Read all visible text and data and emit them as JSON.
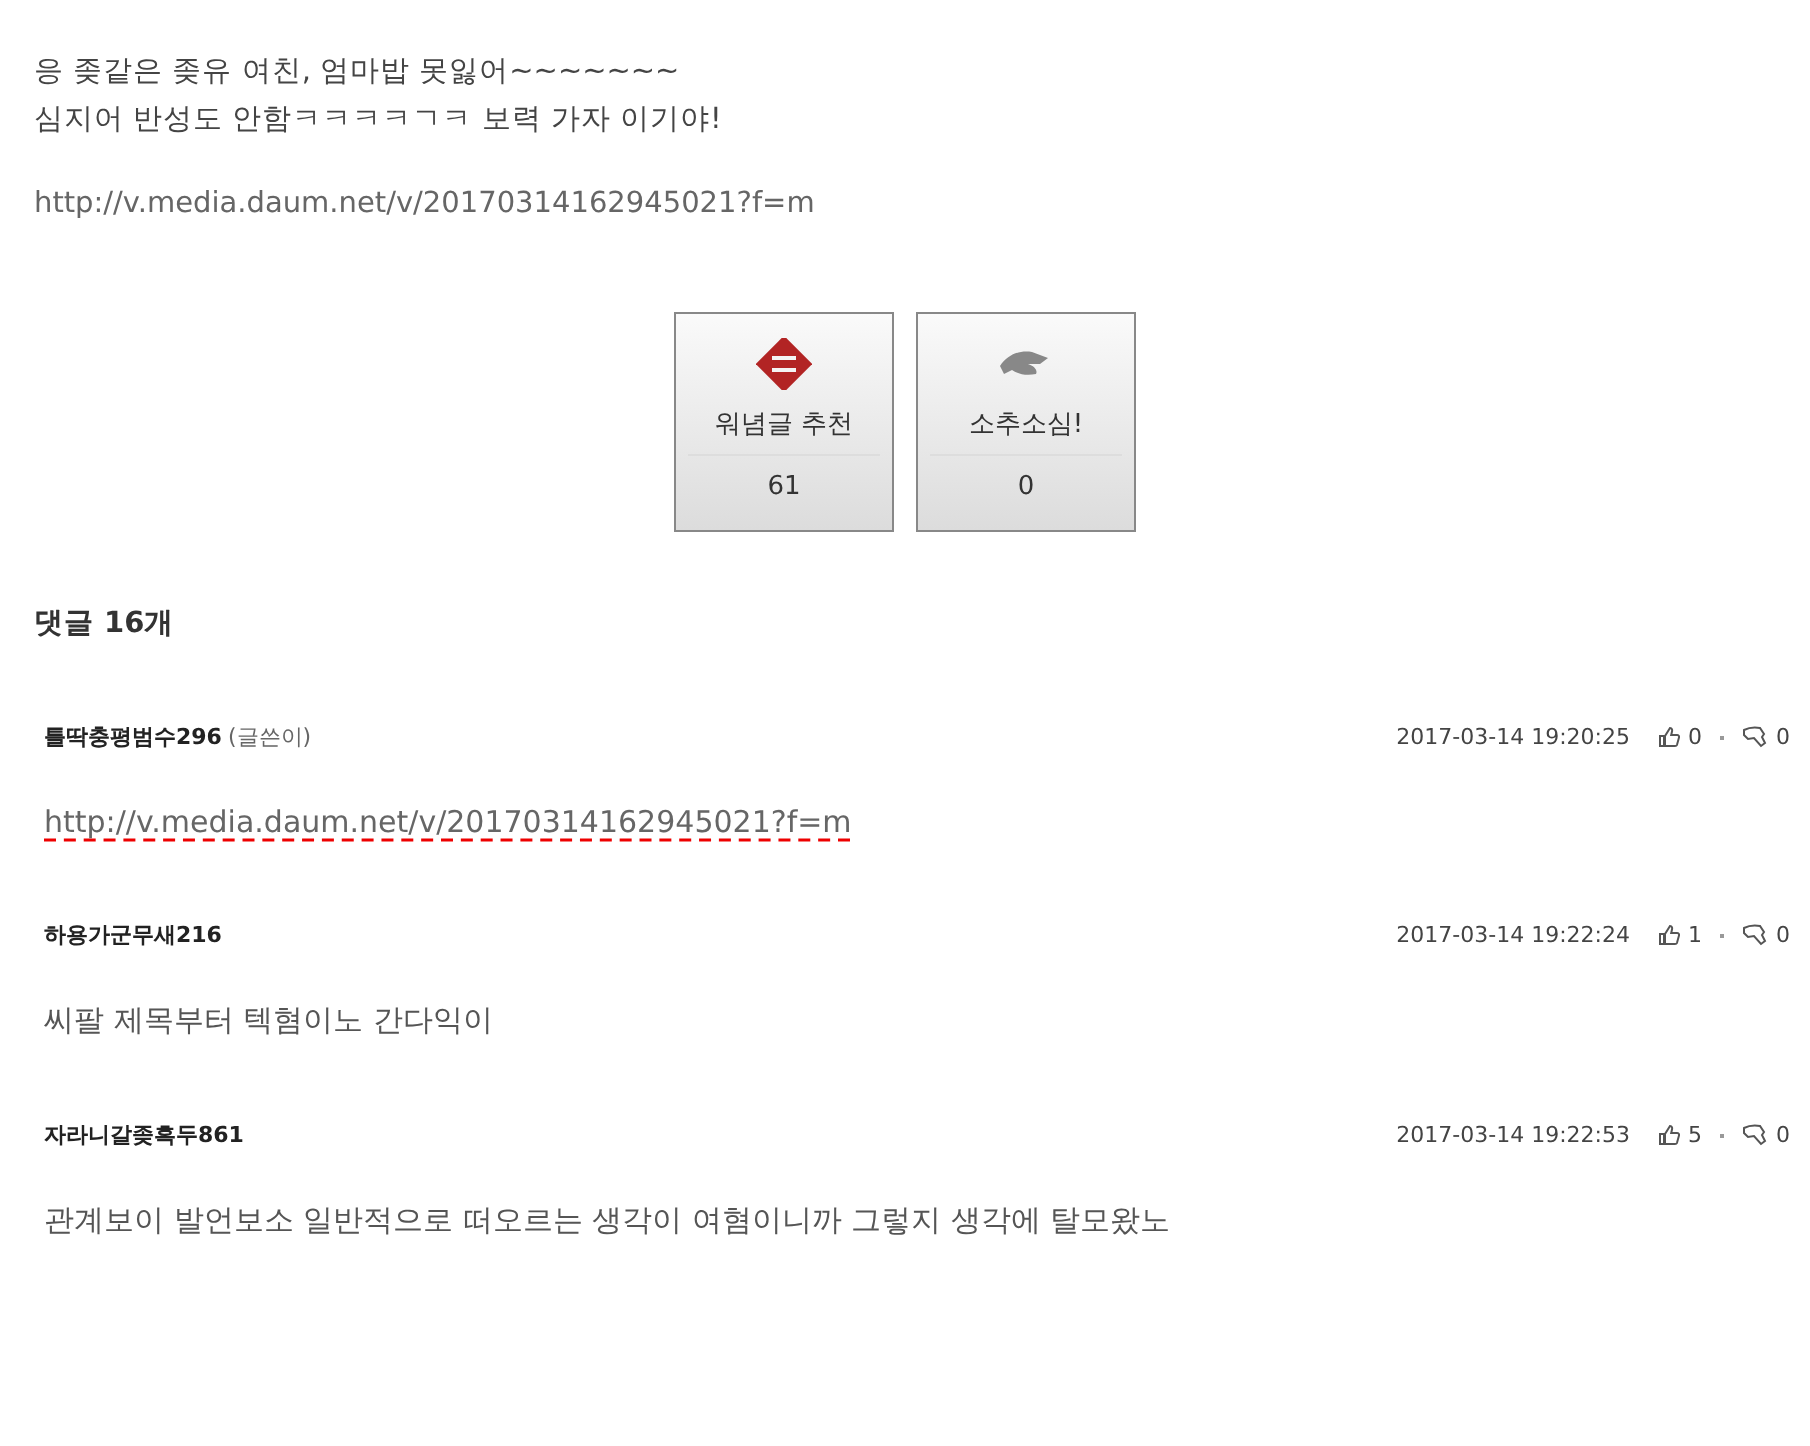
{
  "post": {
    "lines": [
      "응 좆같은 좆유 여친, 엄마밥 못잃어~~~~~~~",
      "심지어 반성도 안함ㅋㅋㅋㅋㄱㅋ 보력 가자 이기야!"
    ],
    "link": "http://v.media.daum.net/v/20170314162945021?f=m"
  },
  "votes": [
    {
      "kind": "up",
      "label": "워념글 추천",
      "count": "61"
    },
    {
      "kind": "down",
      "label": "소추소심!",
      "count": "0"
    }
  ],
  "comments_header": "댓글 16개",
  "comments": [
    {
      "author": "틀딱충평범수296",
      "author_tag": "(글쓴이)",
      "time": "2017-03-14 19:20:25",
      "likes": "0",
      "dislikes": "0",
      "kind": "link",
      "text": "http://v.media.daum.net/v/20170314162945021?f=m"
    },
    {
      "author": "하용가군무새216",
      "time": "2017-03-14 19:22:24",
      "likes": "1",
      "dislikes": "0",
      "kind": "text",
      "text": "씨팔 제목부터 텍혐이노 간다익이"
    },
    {
      "author": "자라니갈좆흑두861",
      "time": "2017-03-14 19:22:53",
      "likes": "5",
      "dislikes": "0",
      "kind": "text",
      "text": "관계보이 발언보소 일반적으로 떠오르는 생각이 여혐이니까 그렇지 생각에 탈모왔노"
    }
  ]
}
